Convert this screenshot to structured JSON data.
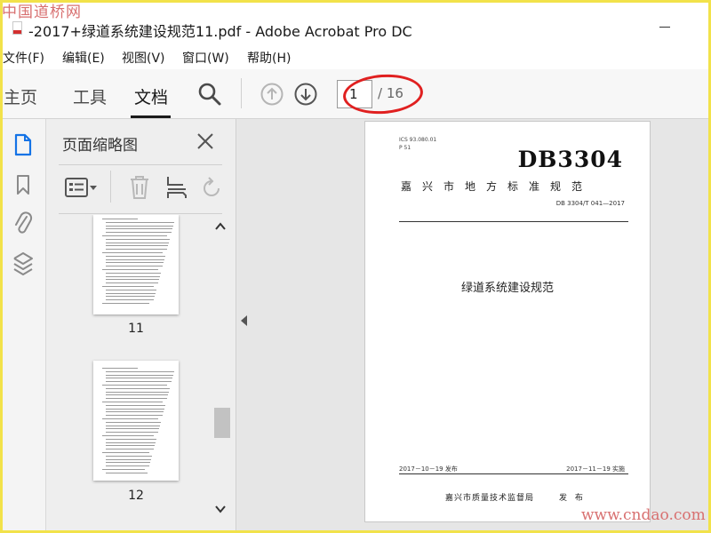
{
  "watermark": {
    "top_left": "中国道桥网",
    "bottom_right": "www.cndao.com"
  },
  "window": {
    "title": "-2017+绿道系统建设规范11.pdf - Adobe Acrobat Pro DC"
  },
  "menu": [
    "文件(F)",
    "编辑(E)",
    "视图(V)",
    "窗口(W)",
    "帮助(H)"
  ],
  "toolbar": {
    "tabs": [
      "主页",
      "工具",
      "文档"
    ],
    "active_tab": "文档",
    "page_current": "1",
    "page_total": "/ 16",
    "icons": [
      "search-icon",
      "previous-page-icon",
      "next-page-icon"
    ]
  },
  "rail": {
    "icons": [
      "page-thumbnails-icon",
      "bookmarks-icon",
      "attachments-icon",
      "layers-icon"
    ]
  },
  "thumbnails_panel": {
    "title": "页面缩略图",
    "tool_icons": [
      "page-options-icon",
      "delete-page-icon",
      "extract-page-icon",
      "rotate-page-icon"
    ],
    "pages": [
      {
        "number": "11"
      },
      {
        "number": "12"
      }
    ]
  },
  "document": {
    "ics": "ICS 93.080.01",
    "class_code": "P 51",
    "code": "DB3304",
    "standard_type": "嘉兴市地方标准规范",
    "standard_number": "DB 3304/T 041—2017",
    "title": "绿道系统建设规范",
    "issued": "2017－10－19 发布",
    "implemented": "2017－11－19 实施",
    "issuer": "嘉兴市质量技术监督局",
    "issuer_suffix": "发 布"
  },
  "colors": {
    "accent": "#1473e6",
    "annotation": "#e02020",
    "watermark": "#d87070",
    "frame": "#f2e24a"
  }
}
